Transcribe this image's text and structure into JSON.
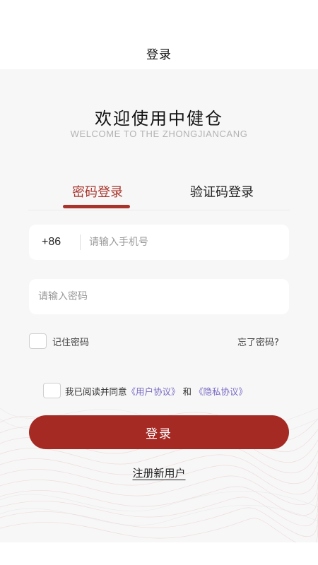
{
  "nav": {
    "title": "登录"
  },
  "welcome": {
    "title": "欢迎使用中健仓",
    "subtitle": "WELCOME TO THE ZHONGJIANCANG"
  },
  "tabs": [
    {
      "label": "密码登录",
      "active": true
    },
    {
      "label": "验证码登录",
      "active": false
    }
  ],
  "phone": {
    "country_code": "+86",
    "placeholder": "请输入手机号",
    "value": ""
  },
  "password": {
    "placeholder": "请输入密码",
    "value": ""
  },
  "remember": {
    "label": "记住密码",
    "checked": false
  },
  "forgot_label": "忘了密码?",
  "agreement": {
    "checked": false,
    "prefix": "我已阅读并同意",
    "user_agreement": "《用户协议》",
    "and": "和",
    "privacy_policy": "《隐私协议》"
  },
  "login_button": "登录",
  "register_label": "注册新用户",
  "colors": {
    "brand": "#a52a24",
    "tab_active": "#a8342b",
    "link": "#7a6bc4",
    "background": "#f7f7f7"
  }
}
